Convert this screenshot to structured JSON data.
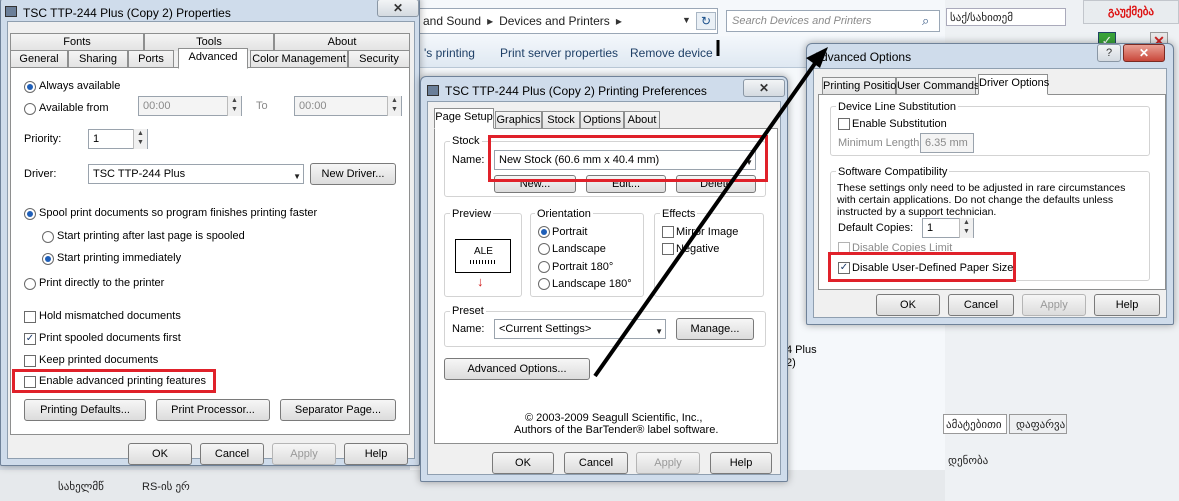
{
  "background": {
    "breadcrumb": [
      "and Sound",
      "Devices and Printers"
    ],
    "search_placeholder": "Search Devices and Printers",
    "commands": [
      "'s printing",
      "Print server properties",
      "Remove device"
    ],
    "printer_label_1": "4 Plus",
    "printer_label_2": "2)",
    "georgian_close": "გაუქმება",
    "georgian_labels": [
      "საქ/სახითემ",
      "ამატებითი",
      "დაფარვა",
      "დენობა",
      "სახელმწ",
      "RS-ის ერ"
    ]
  },
  "props": {
    "title": "TSC TTP-244 Plus (Copy 2) Properties",
    "tabs_row1": [
      "Fonts",
      "Tools",
      "About"
    ],
    "tabs_row2": [
      "General",
      "Sharing",
      "Ports",
      "Advanced",
      "Color Management",
      "Security"
    ],
    "always_available": "Always available",
    "available_from": "Available from",
    "from_time": "00:00",
    "to_label": "To",
    "to_time": "00:00",
    "priority_label": "Priority:",
    "priority_value": "1",
    "driver_label": "Driver:",
    "driver_value": "TSC TTP-244 Plus",
    "new_driver": "New Driver...",
    "spool": "Spool print documents so program finishes printing faster",
    "start_after_last": "Start printing after last page is spooled",
    "start_immediately": "Start printing immediately",
    "print_directly": "Print directly to the printer",
    "hold_mismatched": "Hold mismatched documents",
    "print_spooled_first": "Print spooled documents first",
    "keep_printed": "Keep printed documents",
    "enable_advanced": "Enable advanced printing features",
    "printing_defaults": "Printing Defaults...",
    "print_processor": "Print Processor...",
    "separator_page": "Separator Page...",
    "ok": "OK",
    "cancel": "Cancel",
    "apply": "Apply",
    "help": "Help"
  },
  "prefs": {
    "title": "TSC TTP-244 Plus (Copy 2) Printing Preferences",
    "tabs": [
      "Page Setup",
      "Graphics",
      "Stock",
      "Options",
      "About"
    ],
    "stock_group": "Stock",
    "name_label": "Name:",
    "stock_name": "New Stock (60.6 mm x 40.4 mm)",
    "new_btn": "New...",
    "edit_btn": "Edit...",
    "delete_btn": "Delete",
    "preview_group": "Preview",
    "preview_text": "ALE",
    "orientation_group": "Orientation",
    "portrait": "Portrait",
    "landscape": "Landscape",
    "portrait180": "Portrait 180°",
    "landscape180": "Landscape 180°",
    "effects_group": "Effects",
    "mirror_image": "Mirror Image",
    "negative": "Negative",
    "preset_group": "Preset",
    "preset_name_label": "Name:",
    "preset_value": "<Current Settings>",
    "manage_btn": "Manage...",
    "advanced_options_btn": "Advanced Options...",
    "copyright_1": "© 2003-2009 Seagull Scientific, Inc.,",
    "copyright_2": "Authors of the BarTender® label software.",
    "ok": "OK",
    "cancel": "Cancel",
    "apply": "Apply",
    "help": "Help"
  },
  "adv": {
    "title": "Advanced Options",
    "tabs": [
      "Printing Position",
      "User Commands",
      "Driver Options"
    ],
    "device_line_group": "Device Line Substitution",
    "enable_substitution": "Enable Substitution",
    "minimum_length_label": "Minimum Length:",
    "minimum_length_value": "6.35 mm",
    "software_compat_group": "Software Compatibility",
    "compat_note": "These settings only need to be adjusted in rare circumstances with certain applications.  Do not change the defaults unless instructed by a support technician.",
    "default_copies_label": "Default Copies:",
    "default_copies_value": "1",
    "disable_copies_limit": "Disable Copies Limit",
    "disable_user_paper": "Disable User-Defined Paper Size",
    "ok": "OK",
    "cancel": "Cancel",
    "apply": "Apply",
    "help": "Help"
  },
  "colors": {
    "highlight": "#e0212a",
    "arrow": "#000000"
  }
}
